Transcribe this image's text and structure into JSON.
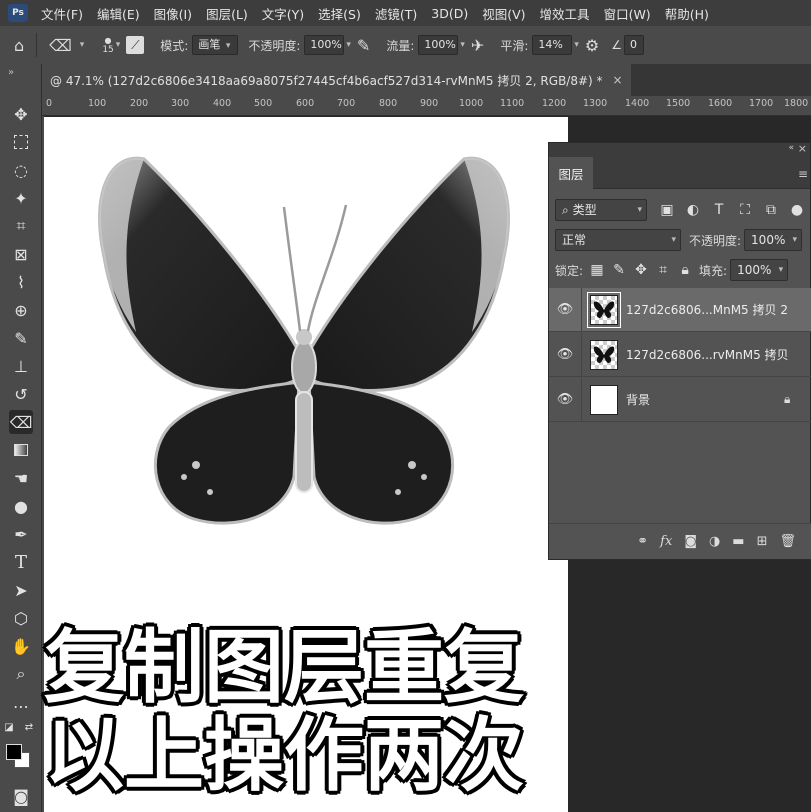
{
  "menubar": {
    "logo": "Ps",
    "items": [
      "文件(F)",
      "编辑(E)",
      "图像(I)",
      "图层(L)",
      "文字(Y)",
      "选择(S)",
      "滤镜(T)",
      "3D(D)",
      "视图(V)",
      "增效工具",
      "窗口(W)",
      "帮助(H)"
    ]
  },
  "options": {
    "brush_size": "15",
    "mode_label": "模式:",
    "mode_value": "画笔",
    "opacity_label": "不透明度:",
    "opacity_value": "100%",
    "flow_label": "流量:",
    "flow_value": "100%",
    "smooth_label": "平滑:",
    "smooth_value": "14%",
    "angle_value": "0"
  },
  "document": {
    "tab_title": "@ 47.1% (127d2c6806e3418aa69a8075f27445cf4b6acf527d314-rvMnM5 拷贝 2, RGB/8#) *",
    "close": "×"
  },
  "ruler": {
    "ticks": [
      "0",
      "100",
      "200",
      "300",
      "400",
      "500",
      "600",
      "700",
      "800",
      "900",
      "1000",
      "1100",
      "1200",
      "1300",
      "1400",
      "1500",
      "1600",
      "1700",
      "1800"
    ]
  },
  "layers_panel": {
    "tab_label": "图层",
    "filter_label": "类型",
    "blend_mode": "正常",
    "opacity_label": "不透明度:",
    "opacity_value": "100%",
    "lock_label": "锁定:",
    "fill_label": "填充:",
    "fill_value": "100%",
    "layers": [
      {
        "name": "127d2c6806...MnM5 拷贝 2",
        "selected": true,
        "visible": true
      },
      {
        "name": "127d2c6806...rvMnM5 拷贝",
        "selected": false,
        "visible": true
      },
      {
        "name": "背景",
        "selected": false,
        "visible": true,
        "locked": true
      }
    ]
  },
  "caption": {
    "line1": "复制图层重复",
    "line2": "以上操作两次"
  }
}
